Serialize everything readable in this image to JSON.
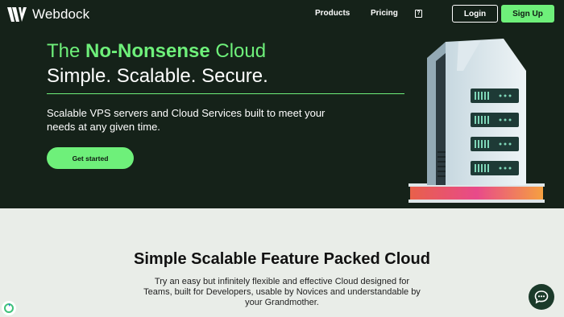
{
  "brand": {
    "name": "Webdock",
    "accent": "#6ef07a",
    "dark": "#152219"
  },
  "nav": {
    "products": "Products",
    "pricing": "Pricing",
    "help_icon": "help-book-icon",
    "login": "Login",
    "signup": "Sign Up"
  },
  "hero": {
    "headline_pre": "The ",
    "headline_bold": "No-Nonsense",
    "headline_post": " Cloud",
    "subheadline": "Simple. Scalable. Secure.",
    "tagline": "Scalable VPS servers and Cloud Services built to meet your needs at any given time.",
    "cta": "Get started",
    "illustration": "server-rack-illustration"
  },
  "feature": {
    "title": "Simple Scalable Feature Packed Cloud",
    "description": "Try an easy but infinitely flexible and effective Cloud designed for Teams, built for Developers, usable by Novices and understandable by your Grandmother."
  },
  "widgets": {
    "chat_icon": "chat-bubble-icon",
    "badge_icon": "recaptcha-badge-icon"
  }
}
